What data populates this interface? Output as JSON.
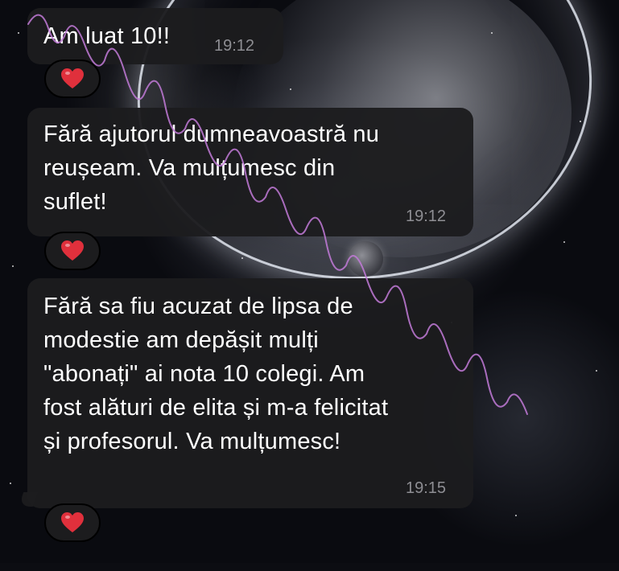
{
  "messages": [
    {
      "text": "Am luat 10!!",
      "time": "19:12",
      "reaction": "❤️"
    },
    {
      "text": "Fără ajutorul dumneavoastră nu\nreușeam. Va mulțumesc din\nsuflet!",
      "time": "19:12",
      "reaction": "❤️"
    },
    {
      "text": "Fără sa fiu acuzat de lipsa de\nmodestie am depășit mulți\n\"abonați\" ai nota 10 colegi. Am\nfost alături de elita și m-a felicitat\nși profesorul. Va mulțumesc!",
      "time": "19:15",
      "reaction": "❤️"
    }
  ],
  "colors": {
    "bubble": "#1c1c1e",
    "text": "#ffffff",
    "timestamp": "#8e8e93",
    "heart": "#e0303c",
    "watermark": "#c27ad8"
  },
  "icons": {
    "reaction": "heart-icon"
  }
}
